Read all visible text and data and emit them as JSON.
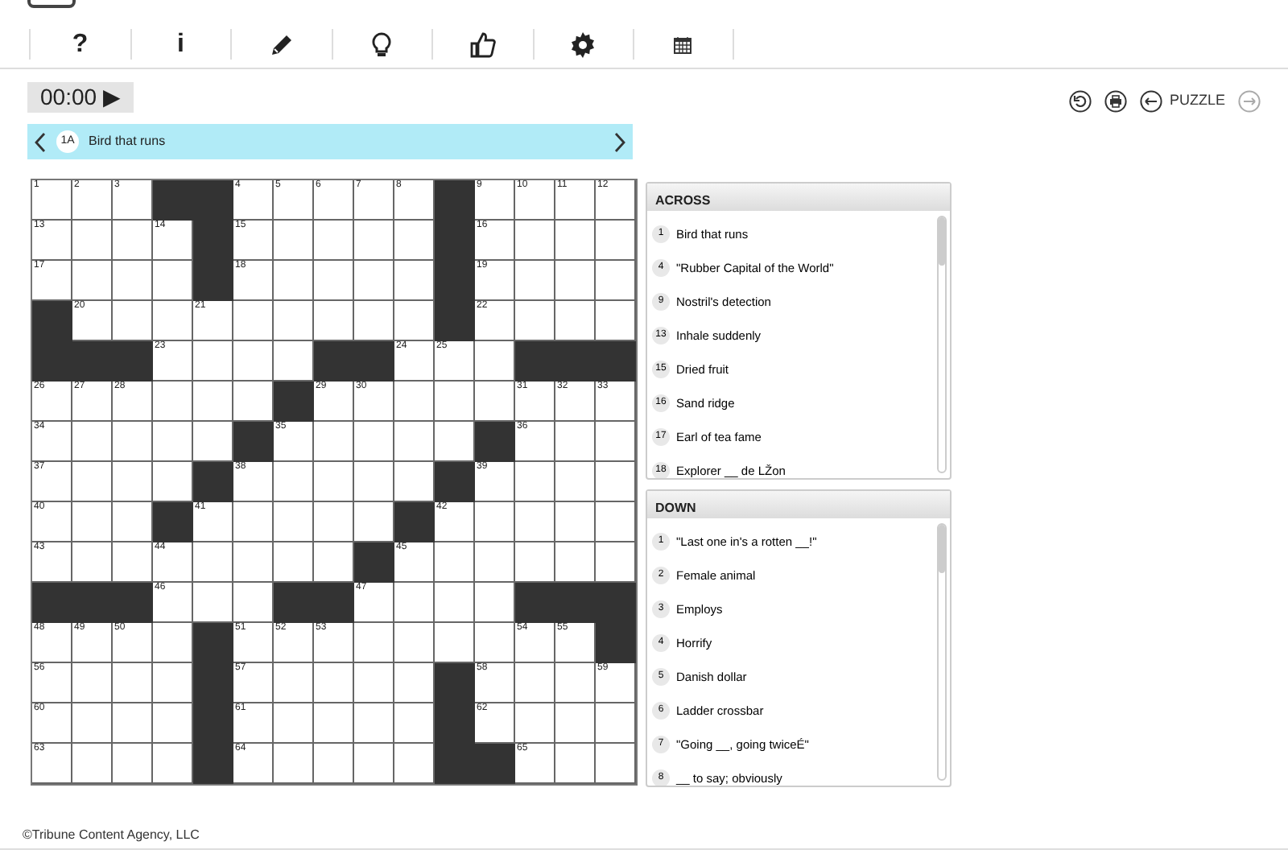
{
  "toolbar": [
    {
      "kind": "glyph",
      "label": "?"
    },
    {
      "kind": "glyph",
      "label": "i"
    },
    {
      "kind": "icon"
    },
    {
      "kind": "icon"
    },
    {
      "kind": "icon"
    },
    {
      "kind": "icon"
    },
    {
      "kind": "icon"
    }
  ],
  "timer": {
    "time": "00:00",
    "play": "▶"
  },
  "nav": {
    "label": "PUZZLE",
    "next_disabled": true
  },
  "current_clue": {
    "number": "1A",
    "text": "Bird that runs"
  },
  "grid": {
    "rows": [
      [
        {
          "block": false,
          "number": "1"
        },
        {
          "block": false,
          "number": "2"
        },
        {
          "block": false,
          "number": "3"
        },
        {
          "block": true
        },
        {
          "block": true
        },
        {
          "block": false,
          "number": "4"
        },
        {
          "block": false,
          "number": "5"
        },
        {
          "block": false,
          "number": "6"
        },
        {
          "block": false,
          "number": "7"
        },
        {
          "block": false,
          "number": "8"
        },
        {
          "block": true
        },
        {
          "block": false,
          "number": "9"
        },
        {
          "block": false,
          "number": "10"
        },
        {
          "block": false,
          "number": "11"
        },
        {
          "block": false,
          "number": "12"
        }
      ],
      [
        {
          "block": false,
          "number": "13"
        },
        {
          "block": false
        },
        {
          "block": false
        },
        {
          "block": false,
          "number": "14"
        },
        {
          "block": true
        },
        {
          "block": false,
          "number": "15"
        },
        {
          "block": false
        },
        {
          "block": false
        },
        {
          "block": false
        },
        {
          "block": false
        },
        {
          "block": true
        },
        {
          "block": false,
          "number": "16"
        },
        {
          "block": false
        },
        {
          "block": false
        },
        {
          "block": false
        }
      ],
      [
        {
          "block": false,
          "number": "17"
        },
        {
          "block": false
        },
        {
          "block": false
        },
        {
          "block": false
        },
        {
          "block": true
        },
        {
          "block": false,
          "number": "18"
        },
        {
          "block": false
        },
        {
          "block": false
        },
        {
          "block": false
        },
        {
          "block": false
        },
        {
          "block": true
        },
        {
          "block": false,
          "number": "19"
        },
        {
          "block": false
        },
        {
          "block": false
        },
        {
          "block": false
        }
      ],
      [
        {
          "block": true
        },
        {
          "block": false,
          "number": "20"
        },
        {
          "block": false
        },
        {
          "block": false
        },
        {
          "block": false,
          "number": "21"
        },
        {
          "block": false
        },
        {
          "block": false
        },
        {
          "block": false
        },
        {
          "block": false
        },
        {
          "block": false
        },
        {
          "block": true
        },
        {
          "block": false,
          "number": "22"
        },
        {
          "block": false
        },
        {
          "block": false
        },
        {
          "block": false
        }
      ],
      [
        {
          "block": true
        },
        {
          "block": true
        },
        {
          "block": true
        },
        {
          "block": false,
          "number": "23"
        },
        {
          "block": false
        },
        {
          "block": false
        },
        {
          "block": false
        },
        {
          "block": true
        },
        {
          "block": true
        },
        {
          "block": false,
          "number": "24"
        },
        {
          "block": false,
          "number": "25"
        },
        {
          "block": false
        },
        {
          "block": true
        },
        {
          "block": true
        },
        {
          "block": true
        }
      ],
      [
        {
          "block": false,
          "number": "26"
        },
        {
          "block": false,
          "number": "27"
        },
        {
          "block": false,
          "number": "28"
        },
        {
          "block": false
        },
        {
          "block": false
        },
        {
          "block": false
        },
        {
          "block": true
        },
        {
          "block": false,
          "number": "29"
        },
        {
          "block": false,
          "number": "30"
        },
        {
          "block": false
        },
        {
          "block": false
        },
        {
          "block": false
        },
        {
          "block": false,
          "number": "31"
        },
        {
          "block": false,
          "number": "32"
        },
        {
          "block": false,
          "number": "33"
        }
      ],
      [
        {
          "block": false,
          "number": "34"
        },
        {
          "block": false
        },
        {
          "block": false
        },
        {
          "block": false
        },
        {
          "block": false
        },
        {
          "block": true
        },
        {
          "block": false,
          "number": "35"
        },
        {
          "block": false
        },
        {
          "block": false
        },
        {
          "block": false
        },
        {
          "block": false
        },
        {
          "block": true
        },
        {
          "block": false,
          "number": "36"
        },
        {
          "block": false
        },
        {
          "block": false
        }
      ],
      [
        {
          "block": false,
          "number": "37"
        },
        {
          "block": false
        },
        {
          "block": false
        },
        {
          "block": false
        },
        {
          "block": true
        },
        {
          "block": false,
          "number": "38"
        },
        {
          "block": false
        },
        {
          "block": false
        },
        {
          "block": false
        },
        {
          "block": false
        },
        {
          "block": true
        },
        {
          "block": false,
          "number": "39"
        },
        {
          "block": false
        },
        {
          "block": false
        },
        {
          "block": false
        }
      ],
      [
        {
          "block": false,
          "number": "40"
        },
        {
          "block": false
        },
        {
          "block": false
        },
        {
          "block": true
        },
        {
          "block": false,
          "number": "41"
        },
        {
          "block": false
        },
        {
          "block": false
        },
        {
          "block": false
        },
        {
          "block": false
        },
        {
          "block": true
        },
        {
          "block": false,
          "number": "42"
        },
        {
          "block": false
        },
        {
          "block": false
        },
        {
          "block": false
        },
        {
          "block": false
        }
      ],
      [
        {
          "block": false,
          "number": "43"
        },
        {
          "block": false
        },
        {
          "block": false
        },
        {
          "block": false,
          "number": "44"
        },
        {
          "block": false
        },
        {
          "block": false
        },
        {
          "block": false
        },
        {
          "block": false
        },
        {
          "block": true
        },
        {
          "block": false,
          "number": "45"
        },
        {
          "block": false
        },
        {
          "block": false
        },
        {
          "block": false
        },
        {
          "block": false
        },
        {
          "block": false
        }
      ],
      [
        {
          "block": true
        },
        {
          "block": true
        },
        {
          "block": true
        },
        {
          "block": false,
          "number": "46"
        },
        {
          "block": false
        },
        {
          "block": false
        },
        {
          "block": true
        },
        {
          "block": true
        },
        {
          "block": false,
          "number": "47"
        },
        {
          "block": false
        },
        {
          "block": false
        },
        {
          "block": false
        },
        {
          "block": true
        },
        {
          "block": true
        },
        {
          "block": true
        }
      ],
      [
        {
          "block": false,
          "number": "48"
        },
        {
          "block": false,
          "number": "49"
        },
        {
          "block": false,
          "number": "50"
        },
        {
          "block": false
        },
        {
          "block": true
        },
        {
          "block": false,
          "number": "51"
        },
        {
          "block": false,
          "number": "52"
        },
        {
          "block": false,
          "number": "53"
        },
        {
          "block": false
        },
        {
          "block": false
        },
        {
          "block": false
        },
        {
          "block": false
        },
        {
          "block": false,
          "number": "54"
        },
        {
          "block": false,
          "number": "55"
        },
        {
          "block": true
        }
      ],
      [
        {
          "block": false,
          "number": "56"
        },
        {
          "block": false
        },
        {
          "block": false
        },
        {
          "block": false
        },
        {
          "block": true
        },
        {
          "block": false,
          "number": "57"
        },
        {
          "block": false
        },
        {
          "block": false
        },
        {
          "block": false
        },
        {
          "block": false
        },
        {
          "block": true
        },
        {
          "block": false,
          "number": "58"
        },
        {
          "block": false
        },
        {
          "block": false
        },
        {
          "block": false,
          "number": "59"
        }
      ],
      [
        {
          "block": false,
          "number": "60"
        },
        {
          "block": false
        },
        {
          "block": false
        },
        {
          "block": false
        },
        {
          "block": true
        },
        {
          "block": false,
          "number": "61"
        },
        {
          "block": false
        },
        {
          "block": false
        },
        {
          "block": false
        },
        {
          "block": false
        },
        {
          "block": true
        },
        {
          "block": false,
          "number": "62"
        },
        {
          "block": false
        },
        {
          "block": false
        },
        {
          "block": false
        }
      ],
      [
        {
          "block": false,
          "number": "63"
        },
        {
          "block": false
        },
        {
          "block": false
        },
        {
          "block": false
        },
        {
          "block": true
        },
        {
          "block": false,
          "number": "64"
        },
        {
          "block": false
        },
        {
          "block": false
        },
        {
          "block": false
        },
        {
          "block": false
        },
        {
          "block": true
        },
        {
          "block": true
        },
        {
          "block": false,
          "number": "65"
        },
        {
          "block": false
        },
        {
          "block": false
        }
      ]
    ]
  },
  "across": {
    "title": "ACROSS",
    "clues": [
      {
        "number": "1",
        "text": "Bird that runs"
      },
      {
        "number": "4",
        "text": "\"Rubber Capital of the World\""
      },
      {
        "number": "9",
        "text": "Nostril's detection"
      },
      {
        "number": "13",
        "text": "Inhale suddenly"
      },
      {
        "number": "15",
        "text": "Dried fruit"
      },
      {
        "number": "16",
        "text": "Sand ridge"
      },
      {
        "number": "17",
        "text": "Earl of tea fame"
      },
      {
        "number": "18",
        "text": "Explorer __ de LŽon"
      }
    ]
  },
  "down": {
    "title": "DOWN",
    "clues": [
      {
        "number": "1",
        "text": "\"Last one in's a rotten __!\""
      },
      {
        "number": "2",
        "text": "Female animal"
      },
      {
        "number": "3",
        "text": "Employs"
      },
      {
        "number": "4",
        "text": "Horrify"
      },
      {
        "number": "5",
        "text": "Danish dollar"
      },
      {
        "number": "6",
        "text": "Ladder crossbar"
      },
      {
        "number": "7",
        "text": "\"Going __, going twiceÉ\""
      },
      {
        "number": "8",
        "text": "__ to say; obviously"
      }
    ]
  },
  "footer": "©Tribune Content Agency, LLC"
}
